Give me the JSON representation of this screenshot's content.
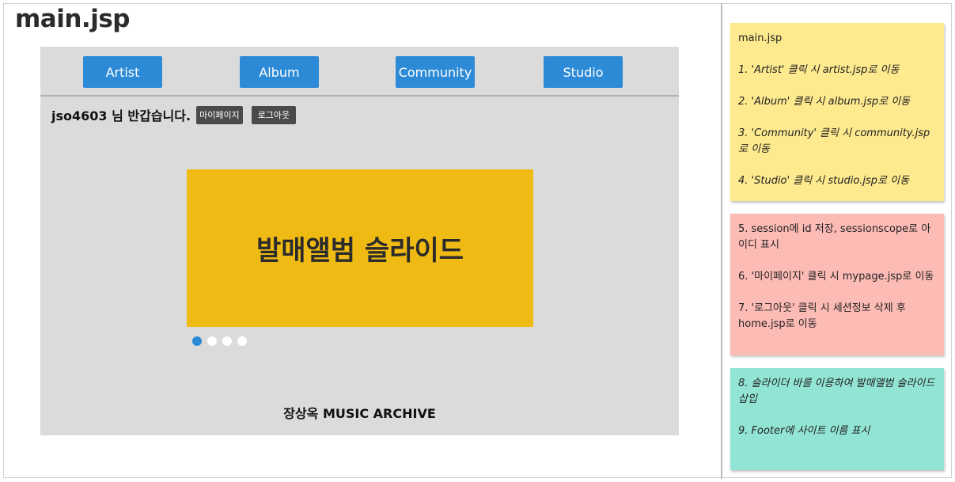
{
  "page_title": "main.jsp",
  "nav": {
    "artist": "Artist",
    "album": "Album",
    "community": "Community",
    "studio": "Studio"
  },
  "greeting": "jso4603 님 반갑습니다.",
  "mypage_button": "마이페이지",
  "logout_button": "로그아웃",
  "slide_title": "발매앨범 슬라이드",
  "slider_dots": {
    "count": 4,
    "active_index": 0
  },
  "footer": "장상옥 MUSIC ARCHIVE",
  "notes": {
    "yellow": {
      "heading": "main.jsp",
      "items": [
        "1. 'Artist' 클릭 시 artist.jsp로 이동",
        "2. 'Album' 클릭 시 album.jsp로 이동",
        "3. 'Community' 클릭 시 community.jsp로 이동",
        "4. 'Studio' 클릭 시 studio.jsp로 이동"
      ]
    },
    "pink": {
      "items": [
        "5. session에 id 저장, sessionscope로 아이디 표시",
        "6. '마이페이지' 클릭 시 mypage.jsp로 이동",
        "7. '로그아웃' 클릭 시 세션정보 삭제 후 home.jsp로 이동"
      ]
    },
    "green": {
      "items": [
        "8. 슬라이더 바를 이용하여 발매앨범 슬라이드 삽입",
        "9. Footer에 사이트 이름 표시"
      ]
    }
  },
  "colors": {
    "nav_button": "#2d8ad6",
    "slide_background": "#efba13",
    "mock_background": "#dbdbdb",
    "note_yellow": "#fde98e",
    "note_pink": "#fdbbb6",
    "note_green": "#92e5d5"
  }
}
